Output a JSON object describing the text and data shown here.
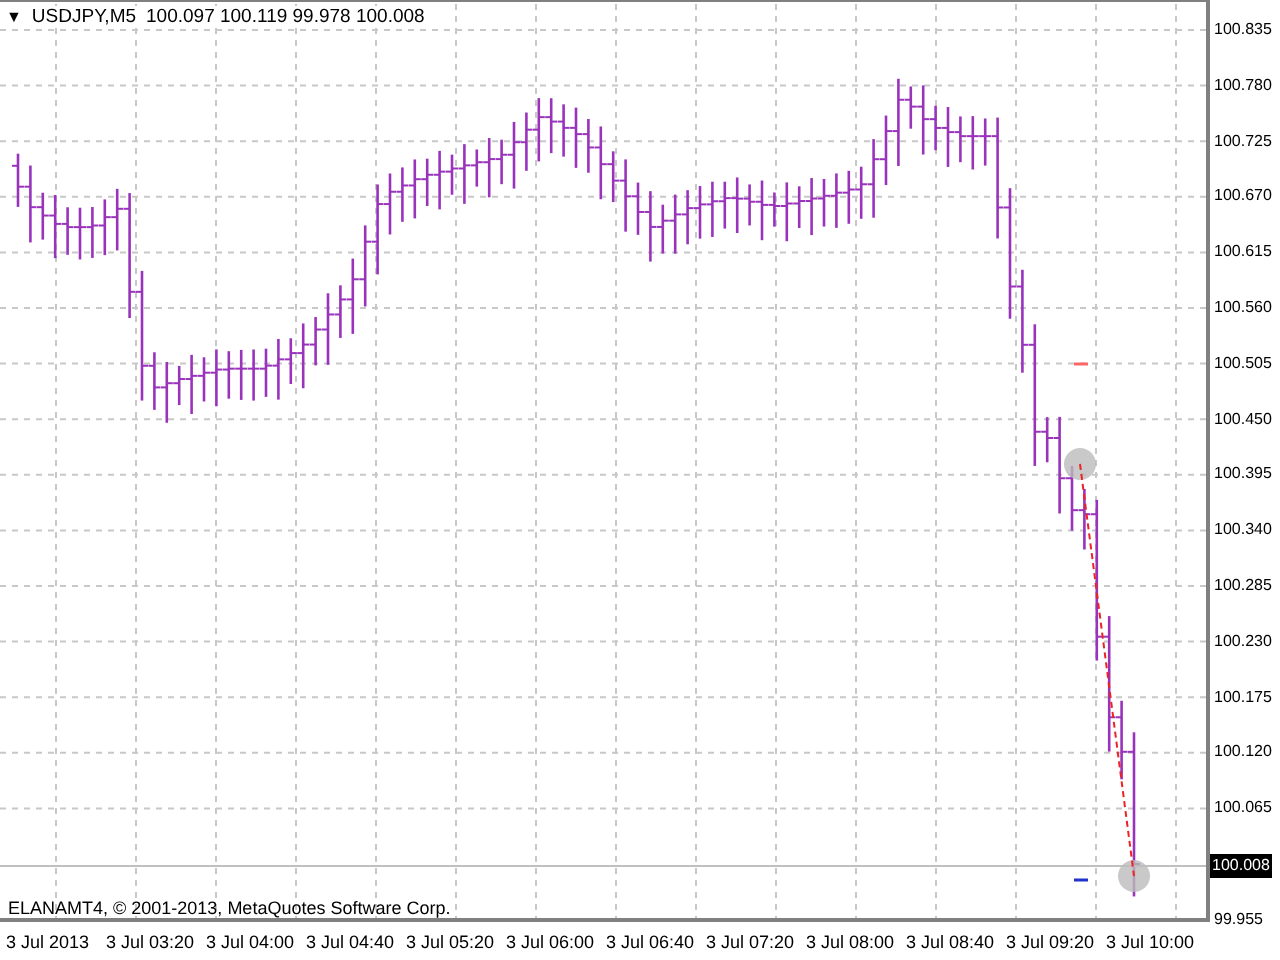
{
  "header": {
    "collapse_glyph": "▼",
    "symbol": "USDJPY,M5",
    "ohlc": "100.097 100.119 99.978 100.008"
  },
  "price_axis": [
    "100.835",
    "100.780",
    "100.725",
    "100.670",
    "100.615",
    "100.560",
    "100.505",
    "100.450",
    "100.395",
    "100.340",
    "100.285",
    "100.230",
    "100.175",
    "100.120",
    "100.065",
    "99.955"
  ],
  "current_price": "100.008",
  "time_axis": [
    "3 Jul 2013",
    "3 Jul 03:20",
    "3 Jul 04:00",
    "3 Jul 04:40",
    "3 Jul 05:20",
    "3 Jul 06:00",
    "3 Jul 06:40",
    "3 Jul 07:20",
    "3 Jul 08:00",
    "3 Jul 08:40",
    "3 Jul 09:20",
    "3 Jul 10:00"
  ],
  "copyright": "ELANAMT4, © 2001-2013, MetaQuotes Software Corp."
}
